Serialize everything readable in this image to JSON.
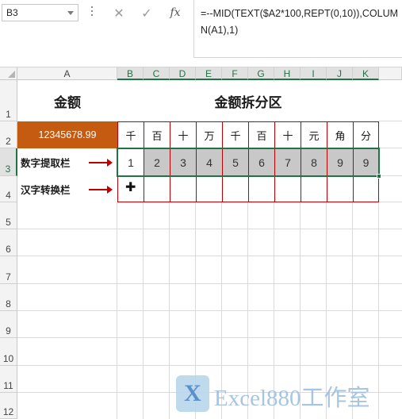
{
  "name_box": {
    "value": "B3"
  },
  "formula_bar": {
    "formula": "=--MID(TEXT($A2*100,REPT(0,10)),COLUMN(A1),1)",
    "cancel_icon": "cross-icon",
    "enter_icon": "check-icon",
    "fx_label": "fx"
  },
  "columns": [
    "A",
    "B",
    "C",
    "D",
    "E",
    "F",
    "G",
    "H",
    "I",
    "J",
    "K"
  ],
  "rows": [
    "1",
    "2",
    "3",
    "4",
    "5",
    "6",
    "7",
    "8",
    "9",
    "10",
    "11",
    "12"
  ],
  "sheet": {
    "a1_title": "金额",
    "b1_title": "金额拆分区",
    "a2_amount": "12345678.99",
    "units": [
      "千",
      "百",
      "十",
      "万",
      "千",
      "百",
      "十",
      "元",
      "角",
      "分"
    ],
    "row3_label": "数字提取栏",
    "row3_digits": [
      "1",
      "2",
      "3",
      "4",
      "5",
      "6",
      "7",
      "8",
      "9",
      "9"
    ],
    "row4_label": "汉字转换栏"
  },
  "colors": {
    "accent_green": "#217346",
    "amount_fill": "#c55a11",
    "border_red": "#c00000",
    "digit_fill": "#c8c8c8"
  },
  "watermark": {
    "logo_letter": "X",
    "text": "Excel880工作室"
  }
}
